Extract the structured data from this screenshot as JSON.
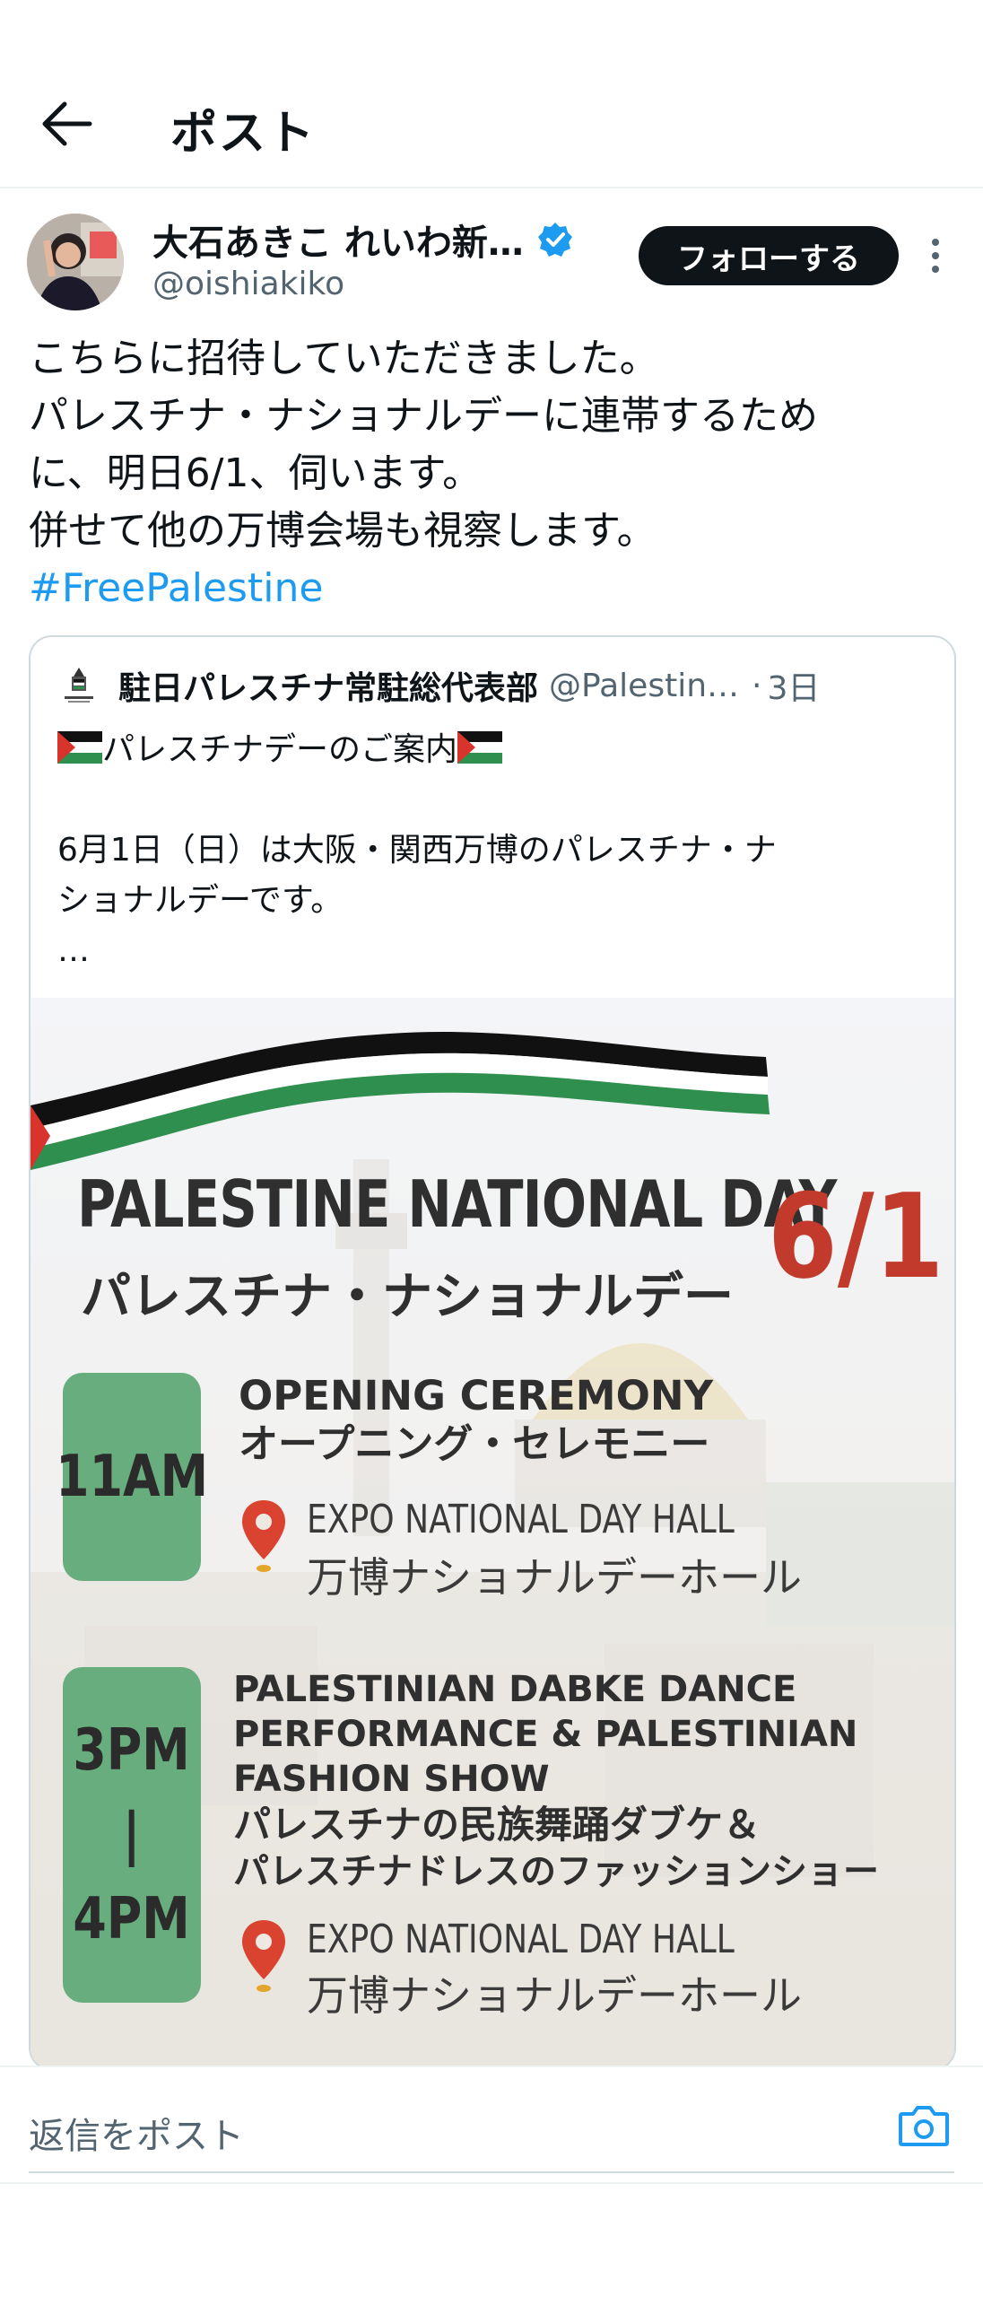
{
  "header": {
    "title": "ポスト",
    "back_icon": "arrow-left-icon"
  },
  "post": {
    "author_name": "大石あきこ れいわ新…",
    "handle": "@oishiakiko",
    "follow_label": "フォローする",
    "body_lines": [
      "こちらに招待していただきました。",
      "パレスチナ・ナショナルデーに連帯するため",
      "に、明日6/1、伺います。",
      "併せて他の万博会場も視察します。"
    ],
    "hashtag": "#FreePalestine"
  },
  "quote": {
    "name": "駐日パレスチナ常駐総代表部",
    "handle": "@Palestin…",
    "dot": "·",
    "time": "3日",
    "line1_text": "パレスチナデーのご案内",
    "line2": "6月1日（日）は大阪・関西万博のパレスチナ・ナ",
    "line3": "ショナルデーです。",
    "ellipsis": "…"
  },
  "poster": {
    "title_en": "PALESTINE NATIONAL DAY",
    "title_jp": "パレスチナ・ナショナルデー",
    "date": "6/1",
    "event1": {
      "time": "11AM",
      "title_en": "OPENING CEREMONY",
      "title_jp": "オープニング・セレモニー",
      "location_en": "EXPO NATIONAL DAY HALL",
      "location_jp": "万博ナショナルデーホール"
    },
    "event2": {
      "time_start": "3PM",
      "time_sep": "|",
      "time_end": "4PM",
      "title_en_1": "PALESTINIAN DABKE DANCE",
      "title_en_2": "PERFORMANCE & PALESTINIAN",
      "title_en_3": "FASHION SHOW",
      "title_jp_1": "パレスチナの民族舞踊ダブケ＆",
      "title_jp_2": "パレスチナドレスのファッションショー",
      "location_en": "EXPO NATIONAL DAY HALL",
      "location_jp": "万博ナショナルデーホール"
    }
  },
  "reply": {
    "placeholder": "返信をポスト",
    "camera_icon": "camera-icon"
  },
  "colors": {
    "link": "#1d9bf0",
    "verified": "#1d9bf0",
    "poster_red": "#c23a2c",
    "poster_green": "#68ad7d"
  }
}
